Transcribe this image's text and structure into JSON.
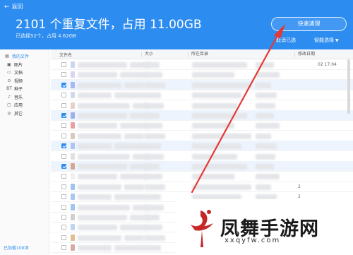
{
  "header": {
    "back_label": "返回",
    "title": "2101 个重复文件，占用 11.00GB",
    "subtitle": "已选择52个，占用 4.62GB",
    "quick_clean_label": "快速清理",
    "unselect_label": "取消已选",
    "smart_select_label": "智能选择",
    "bg_color": "#2d8cf0"
  },
  "sidebar": {
    "items": [
      {
        "label": "我的文件",
        "icon": "folder-icon"
      },
      {
        "label": "图片",
        "icon": "image-icon"
      },
      {
        "label": "文档",
        "icon": "document-icon"
      },
      {
        "label": "视频",
        "icon": "video-icon"
      },
      {
        "label": "种子",
        "icon": "bt-icon"
      },
      {
        "label": "音乐",
        "icon": "music-icon"
      },
      {
        "label": "应用",
        "icon": "app-icon"
      },
      {
        "label": "其它",
        "icon": "other-icon"
      }
    ],
    "footer": "已加载100项"
  },
  "table": {
    "columns": [
      "文件名",
      "大小",
      "所在目录",
      "修改日期"
    ],
    "rows": [
      {
        "checked": false,
        "selected": false,
        "icon_color": "#c8d4f0",
        "date": "02 17:04"
      },
      {
        "checked": false,
        "selected": false,
        "icon_color": "#d6d6f0",
        "date": ""
      },
      {
        "checked": true,
        "selected": true,
        "icon_color": "#a8b8f0",
        "date": ""
      },
      {
        "checked": false,
        "selected": false,
        "icon_color": "#d0d8ea",
        "date": ""
      },
      {
        "checked": false,
        "selected": false,
        "icon_color": "#e8d0c8",
        "date": ""
      },
      {
        "checked": true,
        "selected": true,
        "icon_color": "#9fb0e8",
        "date": ""
      },
      {
        "checked": false,
        "selected": false,
        "icon_color": "#e8a0a0",
        "date": ""
      },
      {
        "checked": false,
        "selected": false,
        "icon_color": "#d8c8c0",
        "date": ""
      },
      {
        "checked": true,
        "selected": true,
        "icon_color": "#b0c4f0",
        "date": ""
      },
      {
        "checked": false,
        "selected": false,
        "icon_color": "#e0e0e0",
        "date": ""
      },
      {
        "checked": true,
        "selected": true,
        "icon_color": "#d4a890",
        "date": ""
      },
      {
        "checked": false,
        "selected": false,
        "icon_color": "#f0f0f0",
        "date": ""
      },
      {
        "checked": false,
        "selected": false,
        "icon_color": "#9ec4f0",
        "date": "2"
      },
      {
        "checked": false,
        "selected": false,
        "icon_color": "#a8c8f0",
        "date": "2"
      },
      {
        "checked": false,
        "selected": false,
        "icon_color": "#9ec4f0",
        "date": "2"
      },
      {
        "checked": false,
        "selected": false,
        "icon_color": "#d0d0d0",
        "date": ""
      },
      {
        "checked": false,
        "selected": false,
        "icon_color": "#c0d4f0",
        "date": ""
      },
      {
        "checked": false,
        "selected": false,
        "icon_color": "#e0c090",
        "date": ""
      },
      {
        "checked": false,
        "selected": false,
        "icon_color": "#d8a8a8",
        "date": ""
      }
    ]
  },
  "watermark": {
    "text": "凤舞手游网",
    "url": "xxqyfw.com"
  }
}
